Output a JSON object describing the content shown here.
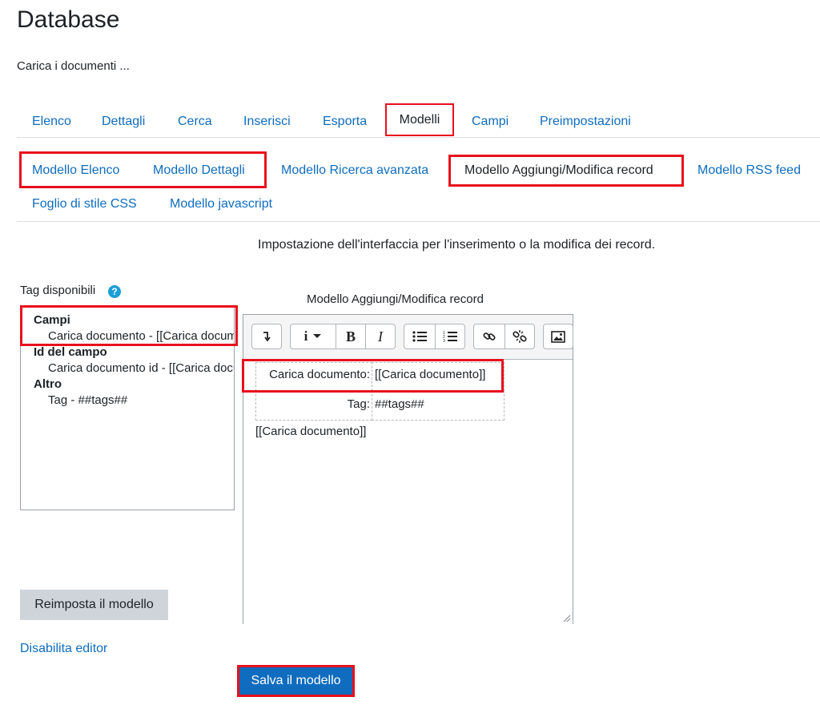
{
  "page": {
    "title": "Database",
    "intro": "Carica i documenti ..."
  },
  "tabs": {
    "items": [
      "Elenco",
      "Dettagli",
      "Cerca",
      "Inserisci",
      "Esporta",
      "Modelli",
      "Campi",
      "Preimpostazioni"
    ],
    "active": "Modelli"
  },
  "subtabs": {
    "row1": [
      "Modello Elenco",
      "Modello Dettagli",
      "Modello Ricerca avanzata",
      "Modello Aggiungi/Modifica record",
      "Modello RSS feed"
    ],
    "row2": [
      "Foglio di stile CSS",
      "Modello javascript"
    ],
    "active": "Modello Aggiungi/Modifica record"
  },
  "description": "Impostazione dell'interfaccia per l'inserimento o la modifica dei record.",
  "tags_panel": {
    "label": "Tag disponibili",
    "help_icon": "question-circle-icon",
    "groups": [
      {
        "heading": "Campi",
        "items": [
          "Carica documento - [[Carica documento]]"
        ]
      },
      {
        "heading": "Id del campo",
        "items": [
          "Carica documento id - [[Carica documento#id]]"
        ]
      },
      {
        "heading": "Altro",
        "items": [
          "Tag - ##tags##"
        ]
      }
    ]
  },
  "editor": {
    "label": "Modello Aggiungi/Modifica record",
    "toolbar": [
      "collapse-icon",
      "info-icon",
      "dropdown-icon",
      "bold-icon",
      "italic-icon",
      "unordered-list-icon",
      "ordered-list-icon",
      "link-icon",
      "unlink-icon",
      "image-icon"
    ],
    "bold_glyph": "B",
    "italic_glyph": "I",
    "table": [
      {
        "label": "Carica documento:",
        "value": "[[Carica documento]]"
      },
      {
        "label": "Tag:",
        "value": "##tags##"
      }
    ],
    "footer_text": "[[Carica documento]]"
  },
  "buttons": {
    "reset": "Reimposta il modello",
    "disable_editor": "Disabilita editor",
    "save": "Salva il modello"
  },
  "colors": {
    "link": "#0f6cbf",
    "highlight": "#e8101c",
    "primary_button": "#0f6cbf",
    "secondary_button": "#ced4da"
  }
}
